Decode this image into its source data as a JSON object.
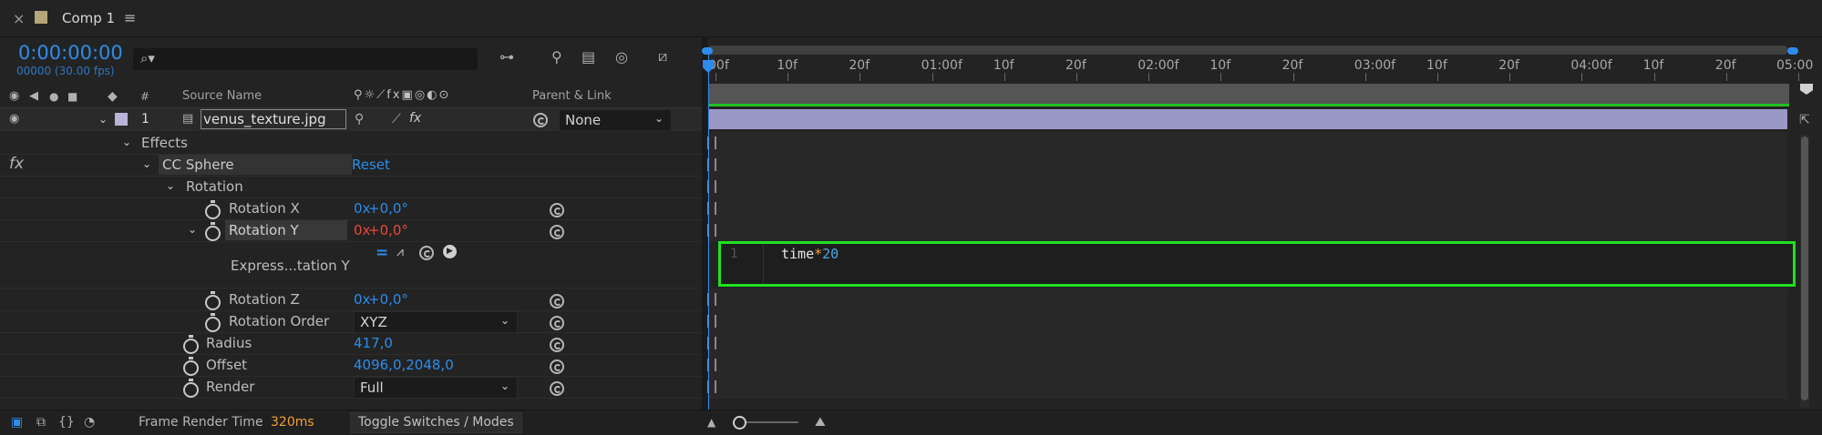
{
  "tab": {
    "close": "×",
    "title": "Comp 1",
    "menu": "≡",
    "swatch_color": "#b5a57a"
  },
  "header": {
    "timecode": "0:00:00:00",
    "frames": "00000 (30.00 fps)",
    "search_placeholder": ""
  },
  "columns": {
    "hash": "#",
    "source_name": "Source Name",
    "parent_link": "Parent & Link"
  },
  "layer": {
    "number": "1",
    "name": "venus_texture.jpg",
    "parent": "None",
    "label_color": "#b7b4d8"
  },
  "effects": {
    "label": "Effects",
    "fx_icon": "fx",
    "effect_name": "CC Sphere",
    "reset": "Reset"
  },
  "properties": {
    "rotation_group": "Rotation",
    "rotation_x": {
      "label": "Rotation X",
      "value_prefix": "0x",
      "value_suffix": "+0,0°"
    },
    "rotation_y": {
      "label": "Rotation Y",
      "value_prefix": "0x",
      "value_suffix": "+0,0°"
    },
    "expression_label": "Express...tation Y",
    "rotation_z": {
      "label": "Rotation Z",
      "value_prefix": "0x",
      "value_suffix": "+0,0°"
    },
    "rotation_order": {
      "label": "Rotation Order",
      "value": "XYZ"
    },
    "radius": {
      "label": "Radius",
      "value": "417,0"
    },
    "offset": {
      "label": "Offset",
      "value": "4096,0,2048,0"
    },
    "render": {
      "label": "Render",
      "value": "Full"
    }
  },
  "ruler": [
    "00f",
    "10f",
    "20f",
    "01:00f",
    "10f",
    "20f",
    "02:00f",
    "10f",
    "20f",
    "03:00f",
    "10f",
    "20f",
    "04:00f",
    "10f",
    "20f",
    "05:00"
  ],
  "expression_editor": {
    "line_number": "1",
    "code_var": "time",
    "code_op": "*",
    "code_num": "20"
  },
  "footer": {
    "render_time_label": "Frame Render Time",
    "render_time_value": "320ms",
    "toggle_label": "Toggle Switches / Modes"
  },
  "colors": {
    "accent": "#2d8ceb",
    "highlight_box": "#20e020",
    "layer_bar": "#9a98c6",
    "work_area": "#20c020"
  }
}
